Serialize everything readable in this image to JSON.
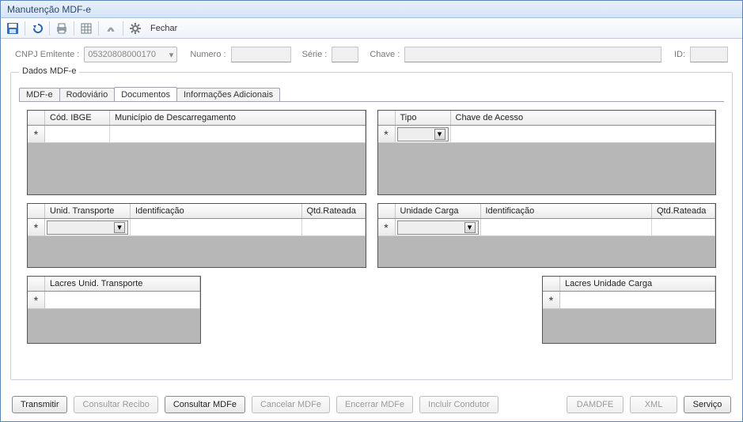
{
  "window": {
    "title": "Manutenção MDF-e"
  },
  "toolbar": {
    "close_label": "Fechar"
  },
  "filter": {
    "cnpj_label": "CNPJ Emitente :",
    "cnpj_value": "05320808000170",
    "numero_label": "Numero :",
    "numero_value": "",
    "serie_label": "Série :",
    "serie_value": "",
    "chave_label": "Chave :",
    "chave_value": "",
    "id_label": "ID:",
    "id_value": ""
  },
  "group": {
    "legend": "Dados MDF-e"
  },
  "tabs": {
    "items": [
      {
        "label": "MDF-e"
      },
      {
        "label": "Rodoviário"
      },
      {
        "label": "Documentos"
      },
      {
        "label": "Informações Adicionais"
      }
    ],
    "active_index": 2
  },
  "grids": {
    "descarregamento": {
      "columns": [
        "Cód. IBGE",
        "Município de Descarregamento"
      ],
      "rows": [
        [
          "",
          ""
        ]
      ]
    },
    "acesso": {
      "columns": [
        "Tipo",
        "Chave de Acesso"
      ],
      "rows": [
        [
          "",
          ""
        ]
      ]
    },
    "unid_transporte": {
      "columns": [
        "Unid. Transporte",
        "Identificação",
        "Qtd.Rateada"
      ],
      "rows": [
        [
          "",
          "",
          ""
        ]
      ]
    },
    "unidade_carga": {
      "columns": [
        "Unidade Carga",
        "Identificação",
        "Qtd.Rateada"
      ],
      "rows": [
        [
          "",
          "",
          ""
        ]
      ]
    },
    "lacres_unid_transporte": {
      "columns": [
        "Lacres Unid. Transporte"
      ],
      "rows": [
        [
          ""
        ]
      ]
    },
    "lacres_unidade_carga": {
      "columns": [
        "Lacres Unidade Carga"
      ],
      "rows": [
        [
          ""
        ]
      ]
    }
  },
  "buttons": {
    "transmitir": "Transmitir",
    "consultar_recibo": "Consultar Recibo",
    "consultar_mdfe": "Consultar MDFe",
    "cancelar_mdfe": "Cancelar MDFe",
    "encerrar_mdfe": "Encerrar MDFe",
    "incluir_condutor": "Incluir Condutor",
    "damdfe": "DAMDFE",
    "xml": "XML",
    "servico": "Serviço"
  }
}
